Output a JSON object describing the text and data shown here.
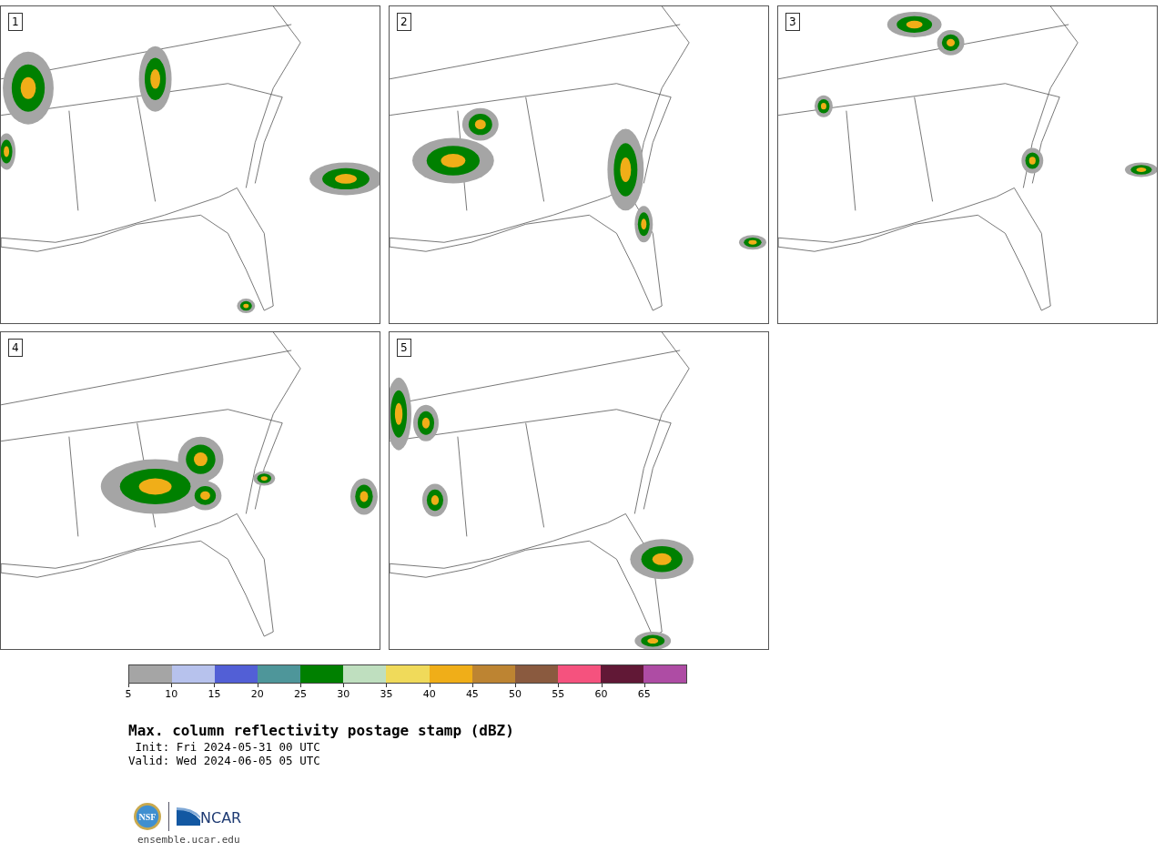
{
  "panels": [
    {
      "label": "1"
    },
    {
      "label": "2"
    },
    {
      "label": "3"
    },
    {
      "label": "4"
    },
    {
      "label": "5"
    }
  ],
  "colorbar": {
    "bins": [
      {
        "label": "5",
        "color": "#a5a5a5"
      },
      {
        "label": "10",
        "color": "#b7c2ed"
      },
      {
        "label": "15",
        "color": "#525fd6"
      },
      {
        "label": "20",
        "color": "#4e969a"
      },
      {
        "label": "25",
        "color": "#008000"
      },
      {
        "label": "30",
        "color": "#bfdfbf"
      },
      {
        "label": "35",
        "color": "#f0da5a"
      },
      {
        "label": "40",
        "color": "#f0ae18"
      },
      {
        "label": "45",
        "color": "#bd8432"
      },
      {
        "label": "50",
        "color": "#8a5a3f"
      },
      {
        "label": "55",
        "color": "#f5527e"
      },
      {
        "label": "60",
        "color": "#611836"
      },
      {
        "label": "65",
        "color": "#ae4ca4"
      }
    ]
  },
  "title": "Max. column reflectivity postage stamp (dBZ)",
  "init": " Init: Fri 2024-05-31 00 UTC",
  "valid": "Valid: Wed 2024-06-05 05 UTC",
  "logos": {
    "nsf": "NSF",
    "ncar": "NCAR"
  },
  "url": "ensemble.ucar.edu"
}
